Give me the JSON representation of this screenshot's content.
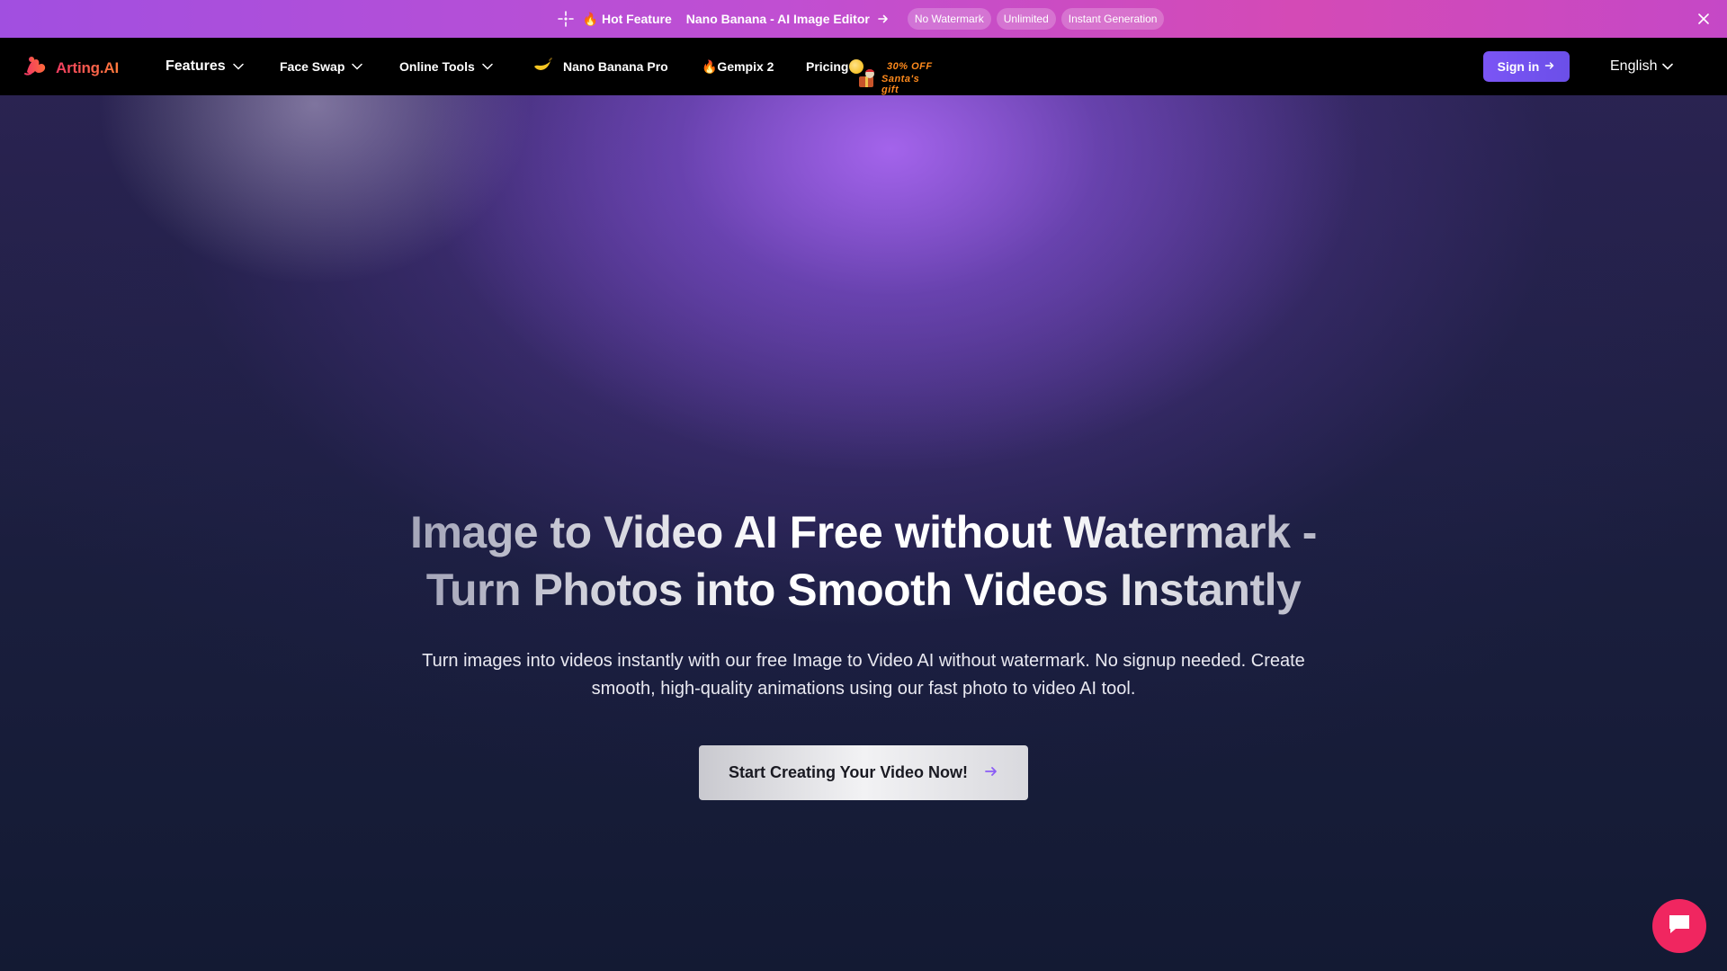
{
  "announcement": {
    "sparkle_icon": "sparkle-icon",
    "fire_emoji": "🔥",
    "hot_label": "Hot Feature",
    "link_text": "Nano Banana - AI Image Editor",
    "pills": [
      "No Watermark",
      "Unlimited",
      "Instant Generation"
    ],
    "close_icon": "close-icon",
    "colors": {
      "start": "#a14fe0",
      "end": "#d44ab6"
    }
  },
  "nav": {
    "logo_text": "Arting.AI",
    "items": {
      "features": "Features",
      "face_swap": "Face Swap",
      "online_tools": "Online Tools",
      "nano_banana_pro": "Nano Banana Pro",
      "gempix": "🔥Gempix 2",
      "pricing": "Pricing"
    },
    "promo": {
      "line1": "30% OFF",
      "line2": "Santa's gift"
    },
    "signin_label": "Sign in",
    "language": "English",
    "colors": {
      "signin": "#7b55f5",
      "logo": "#f23d62"
    }
  },
  "hero": {
    "title_line1": "Image to Video AI Free without Watermark -",
    "title_line2": "Turn Photos into Smooth Videos Instantly",
    "subtitle_line1": "Turn images into videos instantly with our free Image to Video AI without watermark. No signup needed. Create",
    "subtitle_line2": "smooth, high-quality animations using our fast photo to video AI tool.",
    "cta_label": "Start Creating Your Video Now!",
    "accent": "#a866f0"
  },
  "chat": {
    "icon": "chat-bubble-icon",
    "color": "#f02660"
  }
}
